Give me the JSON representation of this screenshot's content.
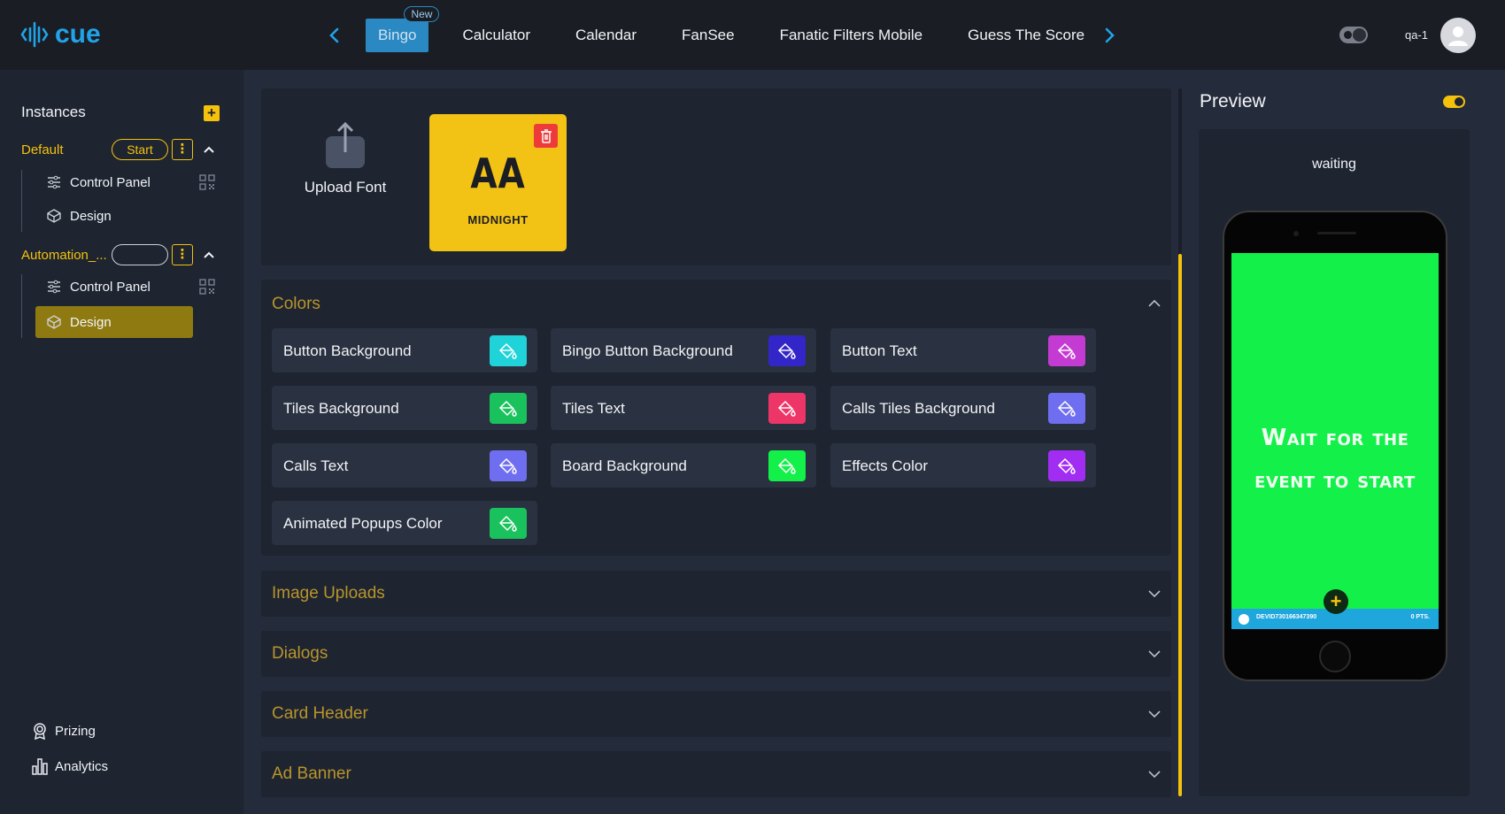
{
  "topbar": {
    "logo_text": "cue",
    "tabs": [
      {
        "label": "Bingo",
        "badge": "New"
      },
      {
        "label": "Calculator"
      },
      {
        "label": "Calendar"
      },
      {
        "label": "FanSee"
      },
      {
        "label": "Fanatic Filters Mobile"
      },
      {
        "label": "Guess The Score"
      }
    ],
    "user_name": "qa-1"
  },
  "sidebar": {
    "title": "Instances",
    "instances": [
      {
        "name": "Default",
        "button": "Start",
        "items": [
          {
            "label": "Control Panel"
          },
          {
            "label": "Design"
          }
        ]
      },
      {
        "name": "Automation_...",
        "button": "",
        "items": [
          {
            "label": "Control Panel"
          },
          {
            "label": "Design",
            "active": true
          }
        ]
      }
    ],
    "bottom": [
      {
        "label": "Prizing"
      },
      {
        "label": "Analytics"
      }
    ]
  },
  "fonts": {
    "upload_label": "Upload Font",
    "font_tile_preview": "AA",
    "font_tile_name": "MIDNIGHT"
  },
  "colors_panel": {
    "title": "Colors",
    "items": [
      {
        "label": "Button Background",
        "color": "#1fd3d8"
      },
      {
        "label": "Bingo Button Background",
        "color": "#3226c9"
      },
      {
        "label": "Button Text",
        "color": "#c43bd3"
      },
      {
        "label": "Tiles Background",
        "color": "#19c25c"
      },
      {
        "label": "Tiles Text",
        "color": "#ee3568"
      },
      {
        "label": "Calls Tiles Background",
        "color": "#6f6ef0"
      },
      {
        "label": "Calls Text",
        "color": "#6f6ef0"
      },
      {
        "label": "Board Background",
        "color": "#13f04a"
      },
      {
        "label": "Effects Color",
        "color": "#a12cf2"
      },
      {
        "label": "Animated Popups Color",
        "color": "#19c25c"
      }
    ]
  },
  "accordions": [
    {
      "title": "Image Uploads"
    },
    {
      "title": "Dialogs"
    },
    {
      "title": "Card Header"
    },
    {
      "title": "Ad Banner"
    }
  ],
  "preview": {
    "title": "Preview",
    "status": "waiting",
    "phone_message_line1": "Wait for the",
    "phone_message_line2": "event to start",
    "footer_id": "DEVID730166347390",
    "footer_points": "0 PTS."
  },
  "accent_color": "#f4c20d",
  "brand_color": "#21a3e8"
}
